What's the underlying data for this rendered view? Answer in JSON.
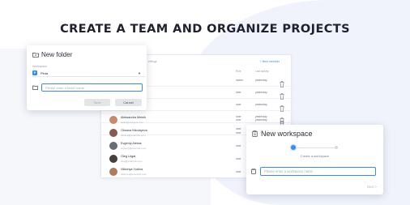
{
  "headline": "CREATE A TEAM AND ORGANIZE PROJECTS",
  "members_table": {
    "tab_label": "ettings",
    "new_member_label": "+ New member",
    "columns": {
      "role": "Role",
      "last_activity": "Last activity"
    },
    "upper_rows": [
      {
        "role": "owner",
        "activity": "yesterday"
      },
      {
        "role": "user",
        "activity": "yesterday"
      },
      {
        "role": "user",
        "activity": "yesterday"
      },
      {
        "role": "user",
        "activity": "yesterday"
      },
      {
        "role": "user",
        "activity": "yesterday"
      }
    ],
    "members": [
      {
        "name": "Aleksandra Melnik",
        "email": "aleks@example.com",
        "role": "user",
        "activity": "yesterday",
        "avatar_color": "#c98a6a"
      },
      {
        "name": "Oksana Nikolayeva",
        "email": "oksana@example.com",
        "role": "user",
        "activity": "yesterday",
        "avatar_color": "#8a5a4a"
      },
      {
        "name": "Evgeniy Alekse",
        "email": "evgeniy@example.com",
        "role": "user",
        "activity": "yesterday",
        "avatar_color": "#6a6e76"
      },
      {
        "name": "Oleg Urgat",
        "email": "oleg@example.com",
        "role": "user",
        "activity": "yesterday",
        "avatar_color": "#4a3e3a"
      },
      {
        "name": "Viktoriya Yudina",
        "email": "viktoriya@example.com",
        "role": "user",
        "activity": "yesterday",
        "avatar_color": "#b47a5e"
      }
    ]
  },
  "folder_dialog": {
    "title": "New folder",
    "workspace_label": "Workspace",
    "workspace_badge": "P",
    "workspace_value": "Pinta",
    "name_placeholder": "Please enter a folder name",
    "save_label": "Save",
    "cancel_label": "Cancel"
  },
  "workspace_dialog": {
    "title": "New workspace",
    "step_label": "Create a workspace",
    "name_placeholder": "Please enter a workspace name",
    "next_label": "Next  >"
  },
  "colors": {
    "accent": "#3a8de8",
    "background_blob": "#f0f3fb"
  }
}
